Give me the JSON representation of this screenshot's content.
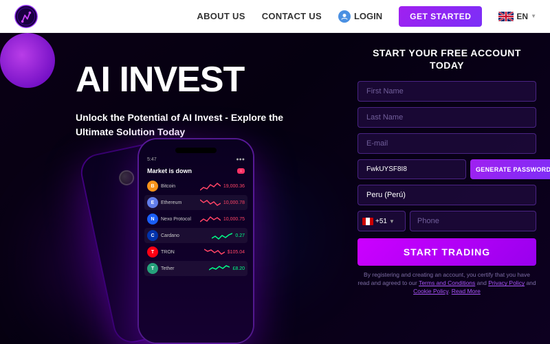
{
  "header": {
    "logo_alt": "AI Invest Logo",
    "nav": {
      "about_us": "ABOUT US",
      "contact_us": "CONTACT US",
      "login": "LOGIN",
      "get_started": "GET STARTED",
      "lang": "EN"
    }
  },
  "hero": {
    "title": "AI INVEST",
    "subtitle": "Unlock the Potential of AI Invest - Explore the Ultimate Solution Today"
  },
  "form": {
    "title": "START YOUR FREE ACCOUNT TODAY",
    "first_name_placeholder": "First Name",
    "last_name_placeholder": "Last Name",
    "email_placeholder": "E-mail",
    "password_value": "FwkUYSF8I8",
    "generate_btn": "GENERATE PASSWORDS",
    "country": "Peru (Perú)",
    "country_code": "+51",
    "phone_placeholder": "Phone",
    "start_trading_btn": "START TRADING",
    "disclaimer": "By registering and creating an account, you certify that you have read and agreed to our Terms and Conditions and Privacy Policy and Cookie Policy. Read More"
  },
  "phone": {
    "status_time": "5:47",
    "market_title": "Market is down",
    "cryptos": [
      {
        "name": "Bitcoin",
        "symbol": "B",
        "color": "#f7931a",
        "price": "19,000.36",
        "change": "-"
      },
      {
        "name": "Ethereum",
        "symbol": "E",
        "color": "#627eea",
        "price": "10,000.78",
        "change": "-"
      },
      {
        "name": "Nexo Protocol",
        "symbol": "N",
        "color": "#1a5ef7",
        "price": "10,000.75",
        "change": "-"
      },
      {
        "name": "Cardano",
        "symbol": "C",
        "color": "#0033ad",
        "price": "0.27",
        "change": "+"
      },
      {
        "name": "TRON",
        "symbol": "T",
        "color": "#ff0013",
        "price": "$105.04",
        "change": "-"
      },
      {
        "name": "Tether",
        "symbol": "T",
        "color": "#26a17b",
        "price": "£8.20",
        "change": "+"
      }
    ]
  }
}
